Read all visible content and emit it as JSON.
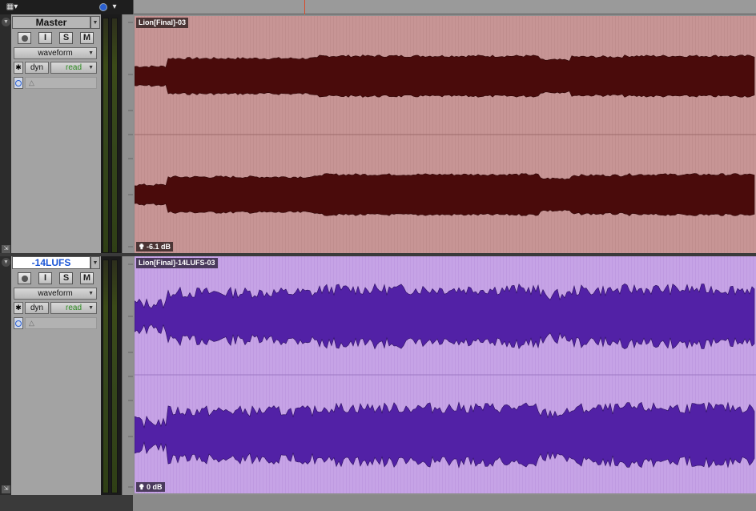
{
  "toolbar": {
    "view_icon": "grid-view-icon",
    "clock_icon": "clock-icon"
  },
  "tracks": [
    {
      "name": "Master",
      "view_mode": "waveform",
      "dyn_label": "dyn",
      "automation_mode": "read",
      "buttons": {
        "input": "I",
        "solo": "S",
        "mute": "M"
      },
      "clip_name": "Lion[Final]-03",
      "clip_gain": "-6.1 dB",
      "clip_color": "#c79595",
      "wave_fill": "#4a0b0b",
      "wave_stroke": "#2b0505"
    },
    {
      "name": "-14LUFS",
      "view_mode": "waveform",
      "dyn_label": "dyn",
      "automation_mode": "read",
      "buttons": {
        "input": "I",
        "solo": "S",
        "mute": "M"
      },
      "clip_name": "Lion[Final]-14LUFS-03",
      "clip_gain": "0 dB",
      "clip_color": "#c6a3e6",
      "wave_fill": "#5221a6",
      "wave_stroke": "#2a0f5c"
    }
  ],
  "colors": {
    "read_text": "#2e8b22",
    "name_selected_text": "#1a55d6",
    "playhead": "#d84a2a"
  }
}
